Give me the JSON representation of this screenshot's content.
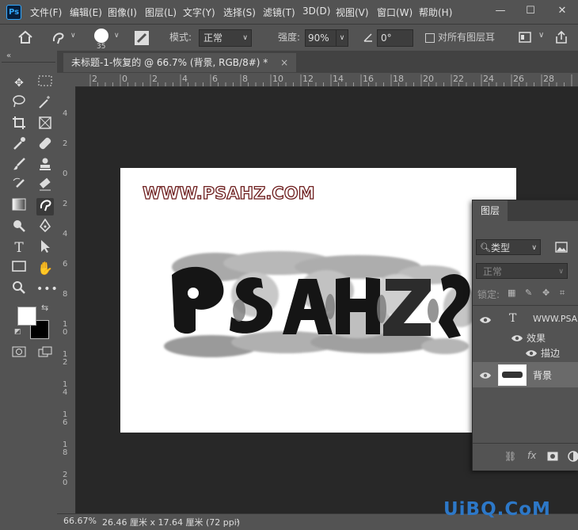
{
  "app": {
    "logo": "Ps"
  },
  "menu": {
    "items": [
      "文件(F)",
      "编辑(E)",
      "图像(I)",
      "图层(L)",
      "文字(Y)",
      "选择(S)",
      "滤镜(T)",
      "3D(D)",
      "视图(V)",
      "窗口(W)",
      "帮助(H)"
    ]
  },
  "window_controls": {
    "minimize": "—",
    "maximize": "☐",
    "close": "✕"
  },
  "options": {
    "brush_size": "35",
    "mode_label": "模式:",
    "mode_value": "正常",
    "strength_label": "强度:",
    "strength_value": "90%",
    "angle_value": "0°",
    "sample_all_label": "对所有图层耳"
  },
  "document": {
    "tab_title": "未标题-1-恢复的 @ 66.7% (背景, RGB/8#) *",
    "close": "×"
  },
  "ruler": {
    "top": [
      "2",
      "0",
      "2",
      "4",
      "6",
      "8",
      "10",
      "12",
      "14",
      "16",
      "18",
      "20",
      "22",
      "24",
      "26",
      "28"
    ],
    "left": [
      "4",
      "2",
      "0",
      "2",
      "4",
      "6",
      "8",
      "1 0",
      "1 2",
      "1 4",
      "1 6",
      "1 8",
      "2 0"
    ]
  },
  "canvas": {
    "watermark": "WWW.PSAHZ.COM",
    "effect_text": "PSAHZ"
  },
  "status": {
    "zoom": "66.67%",
    "doc_size": "26.46 厘米 x 17.64 厘米 (72 ppi)",
    "arrow": "›"
  },
  "layers_panel": {
    "tab": "图层",
    "filter_kind": "类型",
    "blend_mode": "正常",
    "lock_label": "锁定:",
    "layers": [
      {
        "name": "WWW.PSAH",
        "type_icon": "T"
      },
      {
        "name": "效果"
      },
      {
        "name": "描边"
      },
      {
        "name": "背景"
      }
    ],
    "footer_fx": "fx"
  },
  "site_watermark": "UiBQ.CoM",
  "colors": {
    "accent": "#31a8ff",
    "watermark": "#2d78c8",
    "watermark_stroke": "#6b1a1a"
  }
}
